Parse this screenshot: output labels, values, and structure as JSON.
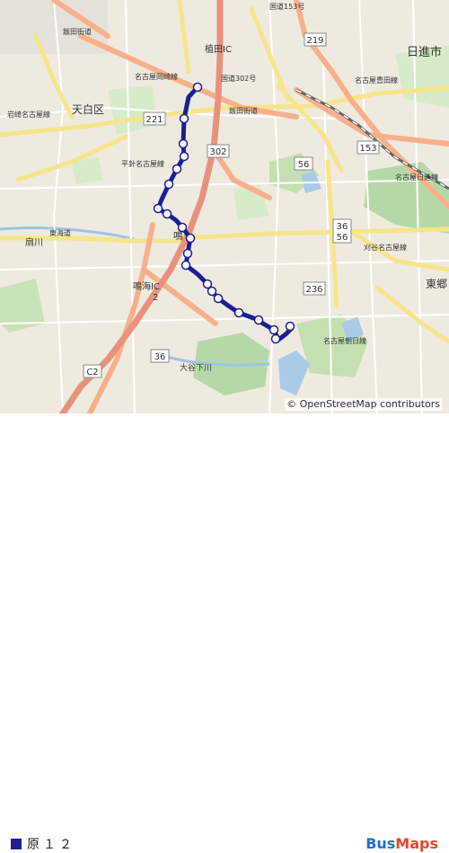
{
  "map": {
    "attribution": "© OpenStreetMap contributors",
    "places": {
      "tenpaku": "天白区",
      "nisshin": "日進市",
      "togo": "東郷",
      "ueda_ic": "植田IC",
      "narumi_ic": "鳴海IC",
      "narumi_ic_no": "2",
      "fujikawa": "扇川",
      "naru": "鳴",
      "okute": "大谷下川"
    },
    "roads": {
      "r302": "302",
      "r219": "219",
      "r221": "221",
      "r153": "153",
      "r56": "56",
      "r36a": "36",
      "r56b": "56",
      "r236": "236",
      "r36b": "36",
      "c2": "C2",
      "iidabashi_top": "飯田街道",
      "iidabashi_mid": "飯田街道",
      "nagoya_kariya": "名古屋岡崎線",
      "hirabari": "平針名古屋線",
      "nagoya_toyota": "名古屋豊田線",
      "kyouto": "国道153号",
      "kariya_nagoya": "刈谷名古屋線",
      "nagoya_nisshin": "名古屋日進線",
      "higashi_kaido": "東海道",
      "kokudo302": "国道302号",
      "iwasaki": "岩崎名古屋線",
      "nagoya_tomiya": "名古屋朝日線"
    }
  },
  "legend": {
    "route_name": "原１２",
    "route_color": "#1a1f94"
  },
  "brand": {
    "part1": "Bus",
    "part2": "Maps"
  }
}
